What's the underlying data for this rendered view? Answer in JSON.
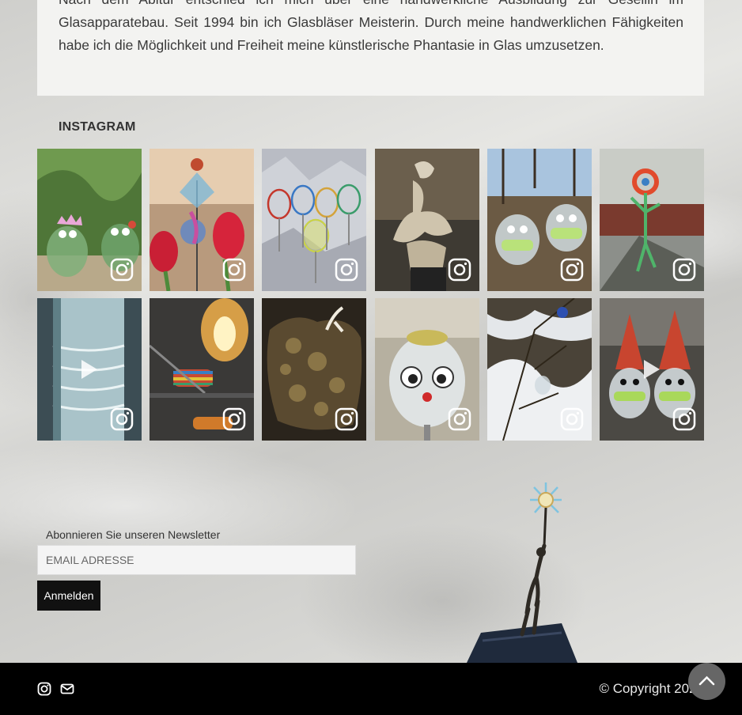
{
  "intro": {
    "line0": "Nach dem Abitur entschied ich mich über eine handwerkliche Ausbildung zur Gesellin im Glasapparatebau. Seit 1994 bin ich Glasbläser Meisterin. Durch meine handwerklichen Fähigkeiten habe ich die Möglichkeit und Freiheit meine künstlerische Phantasie in Glas umzusetzen."
  },
  "instagram": {
    "heading": "INSTAGRAM",
    "tiles": [
      {
        "subject": "green glass frog figures with crowns among plants",
        "video": false
      },
      {
        "subject": "glass figure on a stem with red tulips",
        "video": false
      },
      {
        "subject": "striped wine glasses on crinkled foil",
        "video": false
      },
      {
        "subject": "abstract clay figure sculpture",
        "video": false
      },
      {
        "subject": "glass baubles with masks and eyes outdoors",
        "video": false
      },
      {
        "subject": "glass stick figure with flower by a railway",
        "video": false
      },
      {
        "subject": "clear glass vase with spiral ridges",
        "video": true
      },
      {
        "subject": "lampworking flame with colored glass rods",
        "video": false
      },
      {
        "subject": "dark rock sculpture with small white figure",
        "video": false
      },
      {
        "subject": "clear glass face ornament with eyes",
        "video": false
      },
      {
        "subject": "glass ornaments in snowy branches",
        "video": false
      },
      {
        "subject": "glass baubles with red santa hats",
        "video": true
      }
    ]
  },
  "newsletter": {
    "label": "Abonnieren Sie unseren Newsletter",
    "placeholder": "EMAIL ADRESSE",
    "button": "Anmelden"
  },
  "footer": {
    "copyright": "© Copyright 2021",
    "icons": [
      "instagram-icon",
      "envelope-icon"
    ]
  },
  "colors": {
    "footer_bg": "#000000",
    "button_bg": "#111111",
    "panel_bg": "#f3f3f1"
  }
}
